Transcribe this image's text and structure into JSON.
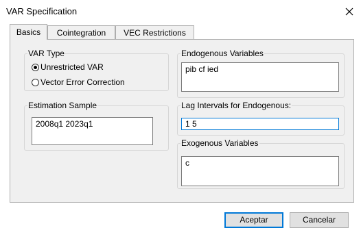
{
  "window": {
    "title": "VAR Specification"
  },
  "tabs": [
    {
      "label": "Basics",
      "active": true
    },
    {
      "label": "Cointegration",
      "active": false
    },
    {
      "label": "VEC Restrictions",
      "active": false
    }
  ],
  "var_type": {
    "legend": "VAR Type",
    "options": [
      {
        "label": "Unrestricted VAR",
        "selected": true
      },
      {
        "label": "Vector Error Correction",
        "selected": false
      }
    ]
  },
  "endogenous": {
    "legend": "Endogenous Variables",
    "value": "pib cf ied"
  },
  "estimation_sample": {
    "legend": "Estimation Sample",
    "value": "2008q1 2023q1"
  },
  "lag_intervals": {
    "legend": "Lag Intervals for Endogenous:",
    "value": "1 5"
  },
  "exogenous": {
    "legend": "Exogenous Variables",
    "value": "c"
  },
  "buttons": {
    "ok": "Aceptar",
    "cancel": "Cancelar"
  },
  "colors": {
    "focus_border": "#0078d7",
    "panel_bg": "#f0f0f0"
  }
}
